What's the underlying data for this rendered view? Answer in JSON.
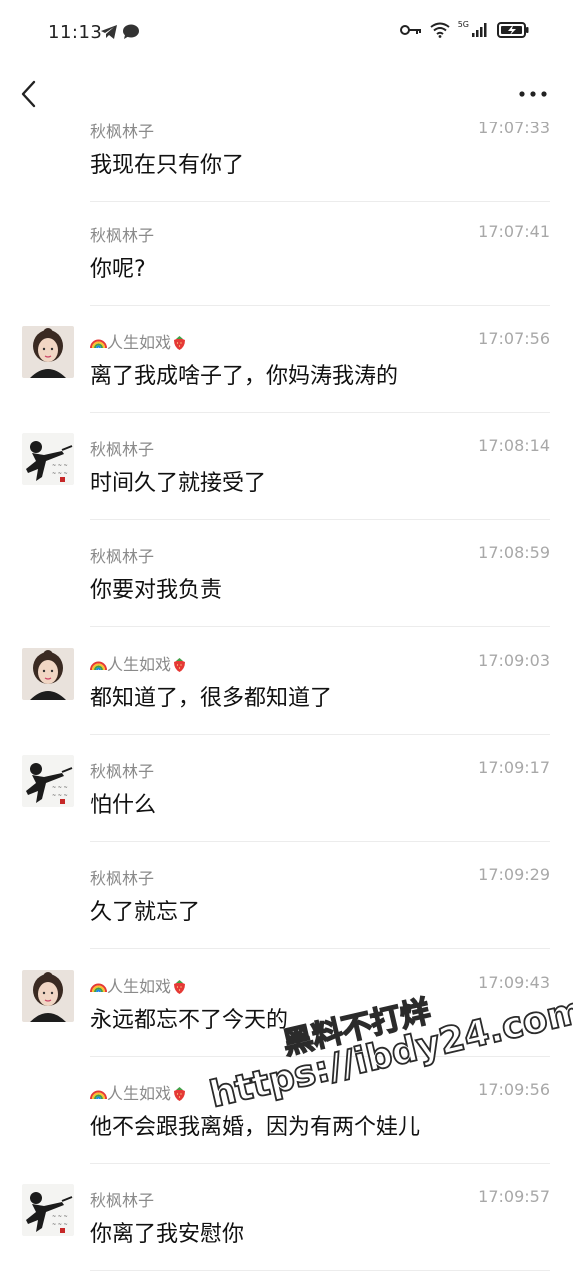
{
  "status_bar": {
    "time": "11:13",
    "network_label": "5G",
    "icons": [
      "telegram-icon",
      "message-icon",
      "key-icon",
      "wifi-icon",
      "signal-icon",
      "battery-charging-icon"
    ]
  },
  "header": {
    "back_icon": "chevron-left-icon",
    "more_icon": "more-dots-icon"
  },
  "messages": [
    {
      "sender": "秋枫林子",
      "time": "17:07:33",
      "text": "我现在只有你了",
      "avatar": "none",
      "partial": true
    },
    {
      "sender": "秋枫林子",
      "time": "17:07:41",
      "text": "你呢?",
      "avatar": "none"
    },
    {
      "sender": "人生如戏",
      "sender_prefix_emoji": "rainbow-icon",
      "sender_suffix_emoji": "strawberry-icon",
      "time": "17:07:56",
      "text": "离了我成啥子了，你妈涛我涛的",
      "avatar": "girl"
    },
    {
      "sender": "秋枫林子",
      "time": "17:08:14",
      "text": "时间久了就接受了",
      "avatar": "boy"
    },
    {
      "sender": "秋枫林子",
      "time": "17:08:59",
      "text": "你要对我负责",
      "avatar": "none"
    },
    {
      "sender": "人生如戏",
      "sender_prefix_emoji": "rainbow-icon",
      "sender_suffix_emoji": "strawberry-icon",
      "time": "17:09:03",
      "text": "都知道了，很多都知道了",
      "avatar": "girl"
    },
    {
      "sender": "秋枫林子",
      "time": "17:09:17",
      "text": "怕什么",
      "avatar": "boy"
    },
    {
      "sender": "秋枫林子",
      "time": "17:09:29",
      "text": "久了就忘了",
      "avatar": "none"
    },
    {
      "sender": "人生如戏",
      "sender_prefix_emoji": "rainbow-icon",
      "sender_suffix_emoji": "strawberry-icon",
      "time": "17:09:43",
      "text": "永远都忘不了今天的",
      "avatar": "girl"
    },
    {
      "sender": "人生如戏",
      "sender_prefix_emoji": "rainbow-icon",
      "sender_suffix_emoji": "strawberry-icon",
      "time": "17:09:56",
      "text": "他不会跟我离婚，因为有两个娃儿",
      "avatar": "none"
    },
    {
      "sender": "秋枫林子",
      "time": "17:09:57",
      "text": "你离了我安慰你",
      "avatar": "boy"
    }
  ],
  "watermark": {
    "line1": "黑料不打烊",
    "line2": "https://ibdy24.com"
  },
  "colors": {
    "sender": "#8a8a8a",
    "time": "#a8a8a8",
    "divider": "#ececec",
    "text": "#111111"
  }
}
